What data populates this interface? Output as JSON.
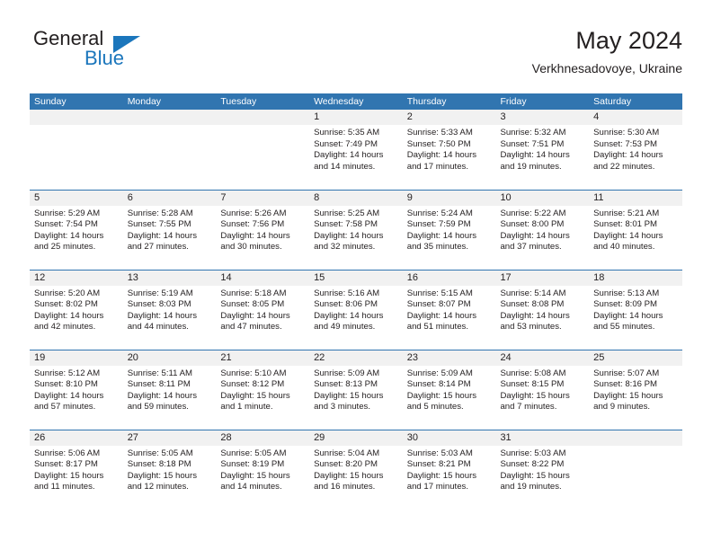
{
  "brand": {
    "name_part1": "General",
    "name_part2": "Blue",
    "triangle_color": "#1b76bc"
  },
  "header": {
    "title": "May 2024",
    "subtitle": "Verkhnesadovoye, Ukraine"
  },
  "theme": {
    "header_blue": "#3175b0",
    "daynum_background": "#f1f1f1",
    "text_color": "#231f20"
  },
  "weekdays": [
    "Sunday",
    "Monday",
    "Tuesday",
    "Wednesday",
    "Thursday",
    "Friday",
    "Saturday"
  ],
  "weeks": [
    [
      {
        "day": "",
        "blank": true
      },
      {
        "day": "",
        "blank": true
      },
      {
        "day": "",
        "blank": true
      },
      {
        "day": "1",
        "sunrise": "Sunrise: 5:35 AM",
        "sunset": "Sunset: 7:49 PM",
        "daylight": "Daylight: 14 hours and 14 minutes."
      },
      {
        "day": "2",
        "sunrise": "Sunrise: 5:33 AM",
        "sunset": "Sunset: 7:50 PM",
        "daylight": "Daylight: 14 hours and 17 minutes."
      },
      {
        "day": "3",
        "sunrise": "Sunrise: 5:32 AM",
        "sunset": "Sunset: 7:51 PM",
        "daylight": "Daylight: 14 hours and 19 minutes."
      },
      {
        "day": "4",
        "sunrise": "Sunrise: 5:30 AM",
        "sunset": "Sunset: 7:53 PM",
        "daylight": "Daylight: 14 hours and 22 minutes."
      }
    ],
    [
      {
        "day": "5",
        "sunrise": "Sunrise: 5:29 AM",
        "sunset": "Sunset: 7:54 PM",
        "daylight": "Daylight: 14 hours and 25 minutes."
      },
      {
        "day": "6",
        "sunrise": "Sunrise: 5:28 AM",
        "sunset": "Sunset: 7:55 PM",
        "daylight": "Daylight: 14 hours and 27 minutes."
      },
      {
        "day": "7",
        "sunrise": "Sunrise: 5:26 AM",
        "sunset": "Sunset: 7:56 PM",
        "daylight": "Daylight: 14 hours and 30 minutes."
      },
      {
        "day": "8",
        "sunrise": "Sunrise: 5:25 AM",
        "sunset": "Sunset: 7:58 PM",
        "daylight": "Daylight: 14 hours and 32 minutes."
      },
      {
        "day": "9",
        "sunrise": "Sunrise: 5:24 AM",
        "sunset": "Sunset: 7:59 PM",
        "daylight": "Daylight: 14 hours and 35 minutes."
      },
      {
        "day": "10",
        "sunrise": "Sunrise: 5:22 AM",
        "sunset": "Sunset: 8:00 PM",
        "daylight": "Daylight: 14 hours and 37 minutes."
      },
      {
        "day": "11",
        "sunrise": "Sunrise: 5:21 AM",
        "sunset": "Sunset: 8:01 PM",
        "daylight": "Daylight: 14 hours and 40 minutes."
      }
    ],
    [
      {
        "day": "12",
        "sunrise": "Sunrise: 5:20 AM",
        "sunset": "Sunset: 8:02 PM",
        "daylight": "Daylight: 14 hours and 42 minutes."
      },
      {
        "day": "13",
        "sunrise": "Sunrise: 5:19 AM",
        "sunset": "Sunset: 8:03 PM",
        "daylight": "Daylight: 14 hours and 44 minutes."
      },
      {
        "day": "14",
        "sunrise": "Sunrise: 5:18 AM",
        "sunset": "Sunset: 8:05 PM",
        "daylight": "Daylight: 14 hours and 47 minutes."
      },
      {
        "day": "15",
        "sunrise": "Sunrise: 5:16 AM",
        "sunset": "Sunset: 8:06 PM",
        "daylight": "Daylight: 14 hours and 49 minutes."
      },
      {
        "day": "16",
        "sunrise": "Sunrise: 5:15 AM",
        "sunset": "Sunset: 8:07 PM",
        "daylight": "Daylight: 14 hours and 51 minutes."
      },
      {
        "day": "17",
        "sunrise": "Sunrise: 5:14 AM",
        "sunset": "Sunset: 8:08 PM",
        "daylight": "Daylight: 14 hours and 53 minutes."
      },
      {
        "day": "18",
        "sunrise": "Sunrise: 5:13 AM",
        "sunset": "Sunset: 8:09 PM",
        "daylight": "Daylight: 14 hours and 55 minutes."
      }
    ],
    [
      {
        "day": "19",
        "sunrise": "Sunrise: 5:12 AM",
        "sunset": "Sunset: 8:10 PM",
        "daylight": "Daylight: 14 hours and 57 minutes."
      },
      {
        "day": "20",
        "sunrise": "Sunrise: 5:11 AM",
        "sunset": "Sunset: 8:11 PM",
        "daylight": "Daylight: 14 hours and 59 minutes."
      },
      {
        "day": "21",
        "sunrise": "Sunrise: 5:10 AM",
        "sunset": "Sunset: 8:12 PM",
        "daylight": "Daylight: 15 hours and 1 minute."
      },
      {
        "day": "22",
        "sunrise": "Sunrise: 5:09 AM",
        "sunset": "Sunset: 8:13 PM",
        "daylight": "Daylight: 15 hours and 3 minutes."
      },
      {
        "day": "23",
        "sunrise": "Sunrise: 5:09 AM",
        "sunset": "Sunset: 8:14 PM",
        "daylight": "Daylight: 15 hours and 5 minutes."
      },
      {
        "day": "24",
        "sunrise": "Sunrise: 5:08 AM",
        "sunset": "Sunset: 8:15 PM",
        "daylight": "Daylight: 15 hours and 7 minutes."
      },
      {
        "day": "25",
        "sunrise": "Sunrise: 5:07 AM",
        "sunset": "Sunset: 8:16 PM",
        "daylight": "Daylight: 15 hours and 9 minutes."
      }
    ],
    [
      {
        "day": "26",
        "sunrise": "Sunrise: 5:06 AM",
        "sunset": "Sunset: 8:17 PM",
        "daylight": "Daylight: 15 hours and 11 minutes."
      },
      {
        "day": "27",
        "sunrise": "Sunrise: 5:05 AM",
        "sunset": "Sunset: 8:18 PM",
        "daylight": "Daylight: 15 hours and 12 minutes."
      },
      {
        "day": "28",
        "sunrise": "Sunrise: 5:05 AM",
        "sunset": "Sunset: 8:19 PM",
        "daylight": "Daylight: 15 hours and 14 minutes."
      },
      {
        "day": "29",
        "sunrise": "Sunrise: 5:04 AM",
        "sunset": "Sunset: 8:20 PM",
        "daylight": "Daylight: 15 hours and 16 minutes."
      },
      {
        "day": "30",
        "sunrise": "Sunrise: 5:03 AM",
        "sunset": "Sunset: 8:21 PM",
        "daylight": "Daylight: 15 hours and 17 minutes."
      },
      {
        "day": "31",
        "sunrise": "Sunrise: 5:03 AM",
        "sunset": "Sunset: 8:22 PM",
        "daylight": "Daylight: 15 hours and 19 minutes."
      },
      {
        "day": "",
        "blank": true
      }
    ]
  ]
}
